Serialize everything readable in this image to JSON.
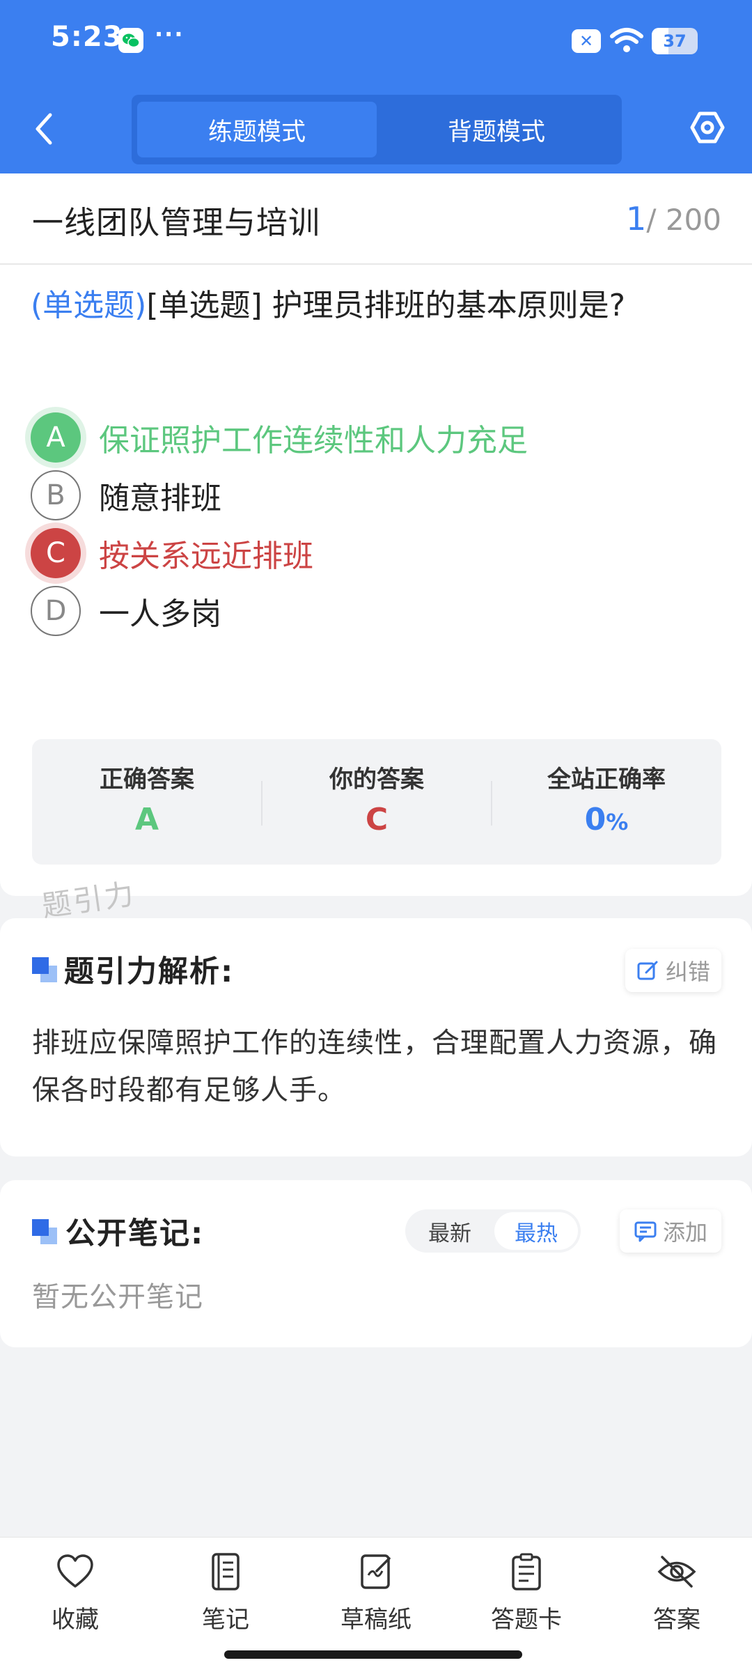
{
  "status_bar": {
    "time": "5:23",
    "more": "···",
    "battery": "37",
    "battery_level": 0.37
  },
  "header": {
    "tabs": [
      {
        "label": "练题模式",
        "active": true
      },
      {
        "label": "背题模式",
        "active": false
      }
    ]
  },
  "question": {
    "subject": "一线团队管理与培训",
    "current": "1",
    "total": "/ 200",
    "type_tag": "(单选题)",
    "stem": "[单选题] 护理员排班的基本原则是?",
    "options": [
      {
        "letter": "A",
        "text": "保证照护工作连续性和人力充足",
        "state": "correct"
      },
      {
        "letter": "B",
        "text": "随意排班",
        "state": "plain"
      },
      {
        "letter": "C",
        "text": "按关系远近排班",
        "state": "wrong"
      },
      {
        "letter": "D",
        "text": "一人多岗",
        "state": "plain"
      }
    ],
    "result": {
      "correct_label": "正确答案",
      "correct_value": "A",
      "mine_label": "你的答案",
      "mine_value": "C",
      "rate_label": "全站正确率",
      "rate_value": "0",
      "rate_unit": "%"
    }
  },
  "watermark": "题引力",
  "analysis": {
    "title": "题引力解析:",
    "report_label": "纠错",
    "body": "排班应保障照护工作的连续性，合理配置人力资源，确保各时段都有足够人手。"
  },
  "notes": {
    "title": "公开笔记:",
    "sort_latest": "最新",
    "sort_hot": "最热",
    "add_label": "添加",
    "empty": "暂无公开笔记"
  },
  "bottom_nav": [
    {
      "label": "收藏",
      "icon": "heart-icon"
    },
    {
      "label": "笔记",
      "icon": "notebook-icon"
    },
    {
      "label": "草稿纸",
      "icon": "draft-paper-icon"
    },
    {
      "label": "答题卡",
      "icon": "answer-sheet-icon"
    },
    {
      "label": "答案",
      "icon": "eye-off-icon"
    }
  ],
  "colors": {
    "primary": "#3b7ff0",
    "correct": "#5cc77e",
    "wrong": "#cc4444"
  }
}
